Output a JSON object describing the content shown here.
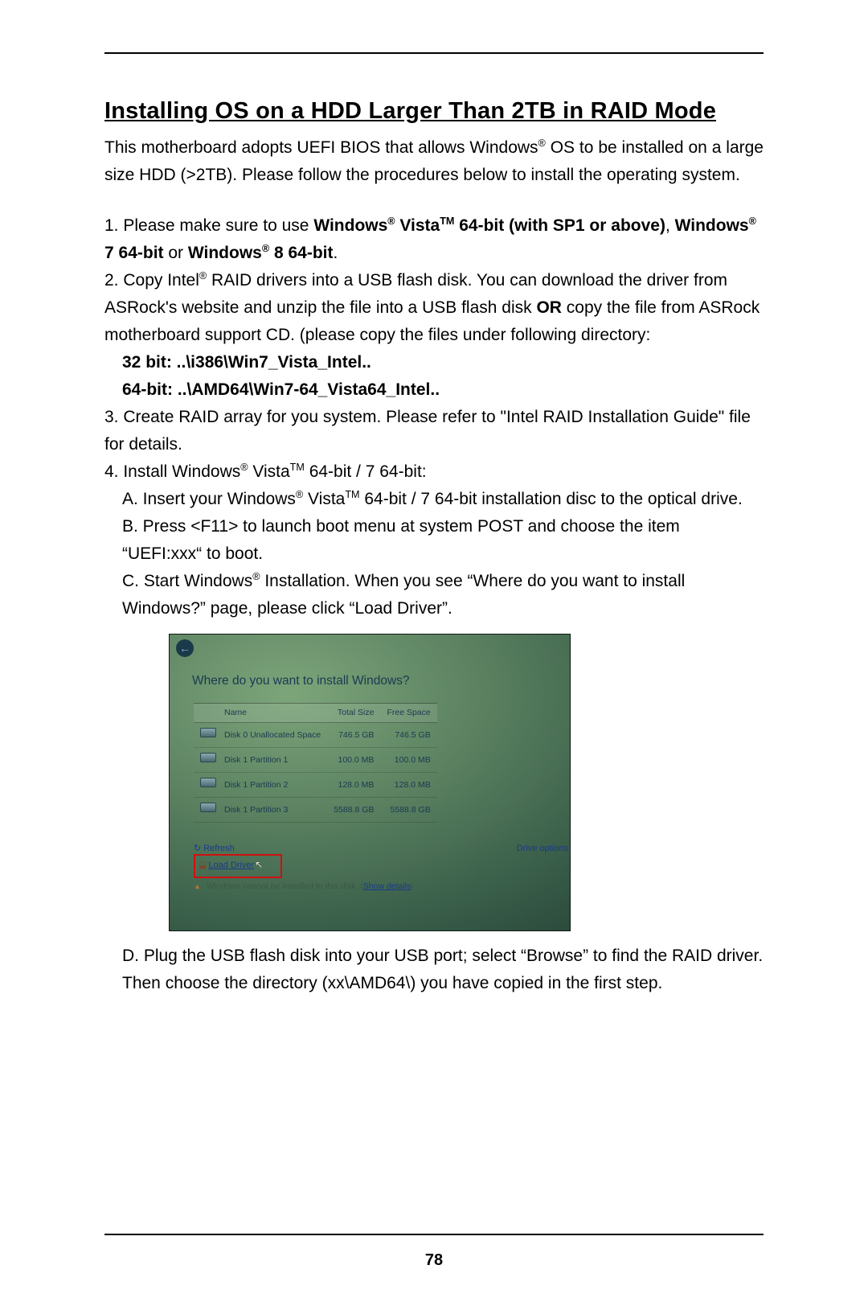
{
  "page_number": "78",
  "title": "Installing OS on a HDD Larger Than 2TB in RAID Mode",
  "intro": "This motherboard adopts UEFI BIOS that allows Windows® OS to be installed on a large size HDD (>2TB). Please follow the procedures below to install the operating system.",
  "step1": {
    "prefix": "1. Please make sure to use ",
    "bold1": "Windows® Vista™ 64-bit (with SP1 or above)",
    "sep": ", ",
    "bold2": "Windows® 7 64-bit",
    "or": " or ",
    "bold3": "Windows® 8 64-bit",
    "end": "."
  },
  "step2": {
    "line1_a": "2. Copy Intel® RAID drivers into a USB flash disk. You can download the driver from ASRock's website and unzip the file into a USB flash disk ",
    "or_bold": "OR",
    "line1_b": " copy the file from ASRock motherboard support CD. (please copy the files under following directory:",
    "path32": "32 bit: ..\\i386\\Win7_Vista_Intel..",
    "path64": "64-bit: ..\\AMD64\\Win7-64_Vista64_Intel.."
  },
  "step3": "3. Create RAID array for you system. Please refer to \"Intel RAID Installation Guide\" file for details.",
  "step4": {
    "head": "4. Install Windows® Vista™ 64-bit / 7 64-bit:",
    "A": "A. Insert your Windows® Vista™ 64-bit / 7 64-bit installation disc to the optical drive.",
    "B": "B. Press <F11> to launch boot menu at system POST and choose the item “UEFI:xxx“ to boot.",
    "C": "C. Start Windows® Installation. When you see “Where do you want to install Windows?” page, please click “Load Driver”.",
    "D": "D. Plug the USB flash disk into your USB port; select “Browse” to find the RAID driver. Then choose the directory (xx\\AMD64\\) you have copied in the first step."
  },
  "screenshot": {
    "title": "Where do you want to install Windows?",
    "headers": {
      "name": "Name",
      "total": "Total Size",
      "free": "Free Space"
    },
    "rows": [
      {
        "name": "Disk 0 Unallocated Space",
        "total": "746.5 GB",
        "free": "746.5 GB"
      },
      {
        "name": "Disk 1 Partition 1",
        "total": "100.0 MB",
        "free": "100.0 MB"
      },
      {
        "name": "Disk 1 Partition 2",
        "total": "128.0 MB",
        "free": "128.0 MB"
      },
      {
        "name": "Disk 1 Partition 3",
        "total": "5588.8 GB",
        "free": "5588.8 GB"
      }
    ],
    "refresh": "Refresh",
    "load_driver": "Load Driver",
    "drive_options": "Drive options",
    "warning_a": "Windows cannot be installed to this disk. (",
    "warning_link": "Show details",
    "warning_b": ")"
  }
}
